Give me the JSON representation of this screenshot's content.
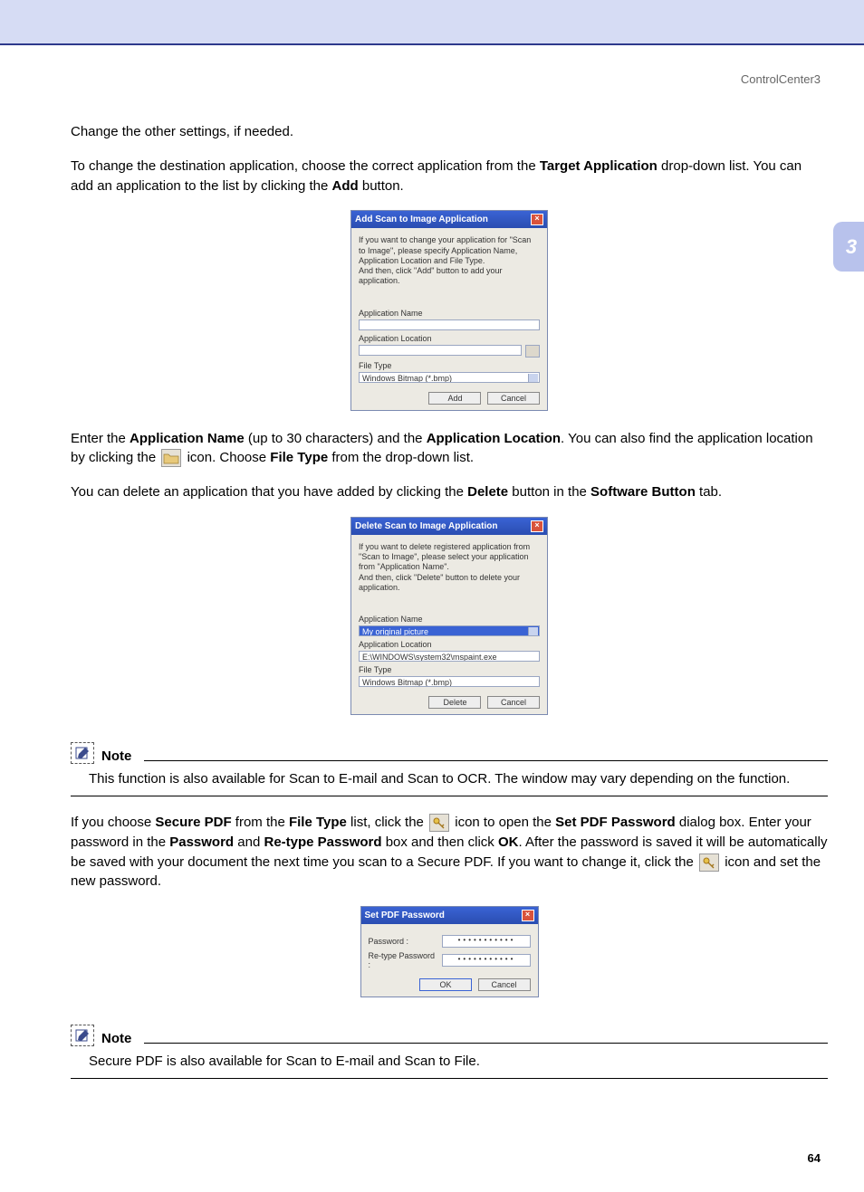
{
  "header": {
    "label": "ControlCenter3"
  },
  "chapter": "3",
  "pageNumber": "64",
  "para": {
    "p1": "Change the other settings, if needed.",
    "p2a": "To change the destination application, choose the correct application from the ",
    "p2b": "Target Application",
    "p2c": " drop-down list. You can add an application to the list by clicking the ",
    "p2d": "Add",
    "p2e": " button.",
    "p3a": "Enter the ",
    "p3b": "Application Name",
    "p3c": " (up to 30 characters) and the ",
    "p3d": "Application Location",
    "p3e": ". You can also find the application location by clicking the ",
    "p3f": " icon. Choose ",
    "p3g": "File Type",
    "p3h": " from the drop-down list.",
    "p4a": "You can delete an application that you have added by clicking the ",
    "p4b": "Delete",
    "p4c": " button in the ",
    "p4d": "Software Button",
    "p4e": " tab.",
    "p5a": "If you choose ",
    "p5b": "Secure PDF",
    "p5c": " from the ",
    "p5d": "File Type",
    "p5e": " list, click the ",
    "p5f": " icon to open the ",
    "p5g": "Set PDF Password",
    "p5h": " dialog box. Enter your password in the ",
    "p5i": "Password",
    "p5j": " and ",
    "p5k": "Re-type Password",
    "p5l": " box and then click ",
    "p5m": "OK",
    "p5n": ". After the password is saved it will be automatically be saved with your document the next time you scan to a Secure PDF. If you want to change it, click the ",
    "p5o": " icon and set the new password."
  },
  "dlgAdd": {
    "title": "Add Scan to Image Application",
    "intro1": "If you want to change your application for \"Scan to Image\", please specify Application Name, Application Location and File Type.",
    "intro2": "And then, click \"Add\" button to add your application.",
    "appNameLabel": "Application Name",
    "appLocLabel": "Application Location",
    "fileTypeLabel": "File Type",
    "fileTypeValue": "Windows Bitmap (*.bmp)",
    "btnAdd": "Add",
    "btnCancel": "Cancel"
  },
  "dlgDel": {
    "title": "Delete Scan to Image Application",
    "intro1": "If you want to delete registered application from \"Scan to Image\", please select your application from \"Application Name\".",
    "intro2": "And then, click \"Delete\" button to delete your application.",
    "appNameLabel": "Application Name",
    "appNameValue": "My original picture",
    "appLocLabel": "Application Location",
    "appLocValue": "E:\\WINDOWS\\system32\\mspaint.exe",
    "fileTypeLabel": "File Type",
    "fileTypeValue": "Windows Bitmap (*.bmp)",
    "btnDelete": "Delete",
    "btnCancel": "Cancel"
  },
  "dlgPdf": {
    "title": "Set PDF Password",
    "passwordLabel": "Password :",
    "rePasswordLabel": "Re-type Password :",
    "maskedValue": "•••••••••••",
    "btnOk": "OK",
    "btnCancel": "Cancel"
  },
  "note1": {
    "title": "Note",
    "body": "This function is also available for Scan to E-mail and Scan to OCR. The window may vary depending on the function."
  },
  "note2": {
    "title": "Note",
    "body": "Secure PDF is also available for Scan to E-mail and Scan to File."
  }
}
